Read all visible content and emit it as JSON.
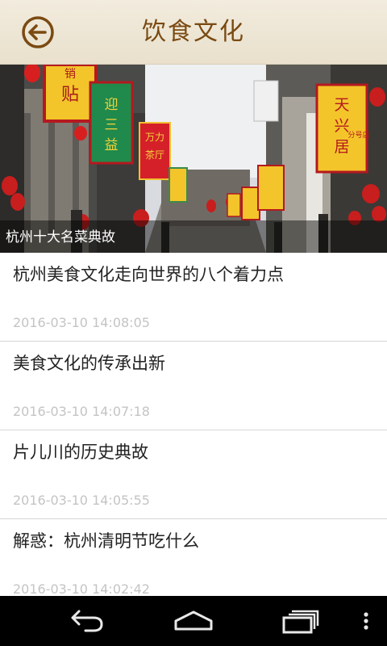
{
  "header": {
    "title": "饮食文化",
    "back_icon": "back-arrow-circle-icon"
  },
  "banner": {
    "caption": "杭州十大名菜典故",
    "banners": [
      "销贴",
      "迎三益",
      "万力茶厅",
      "天兴居",
      "分号店"
    ]
  },
  "articles": [
    {
      "title": "杭州美食文化走向世界的八个着力点",
      "time": "2016-03-10 14:08:05"
    },
    {
      "title": "美食文化的传承出新",
      "time": "2016-03-10 14:07:18"
    },
    {
      "title": "片儿川的历史典故",
      "time": "2016-03-10 14:05:55"
    },
    {
      "title": "解惑：杭州清明节吃什么",
      "time": "2016-03-10 14:02:42"
    }
  ],
  "navbar": {
    "icons": [
      "back-nav-icon",
      "home-nav-icon",
      "recent-apps-icon",
      "menu-overflow-icon"
    ]
  },
  "colors": {
    "header_bg": "#efe8d7",
    "title_brown": "#7a4a12",
    "timestamp_gray": "#c4c4c4",
    "navbar_bg": "#000000"
  }
}
